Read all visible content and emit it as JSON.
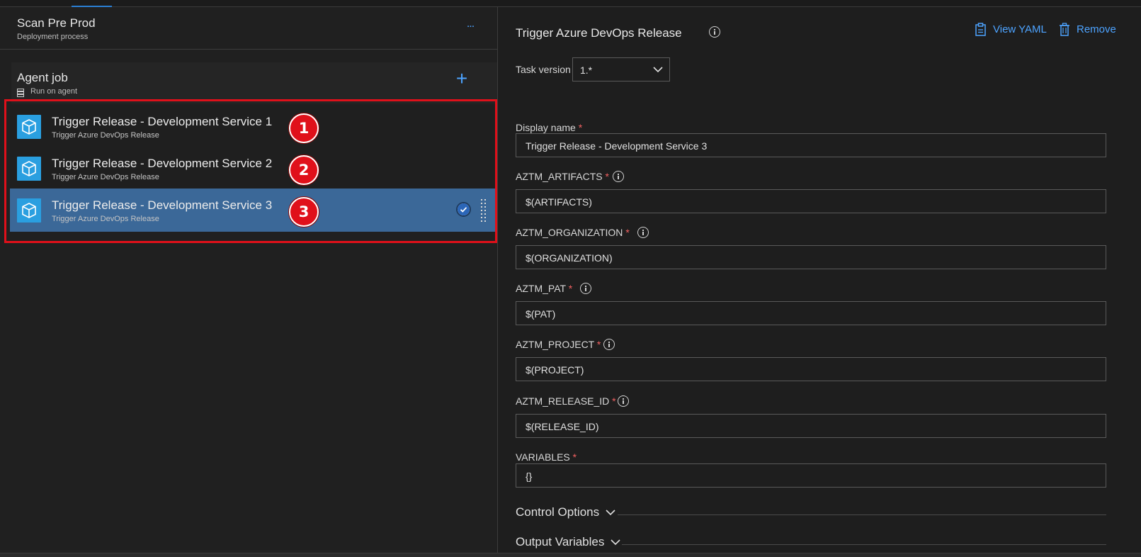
{
  "stage": {
    "title": "Scan Pre Prod",
    "subtitle": "Deployment process",
    "more_label": "..."
  },
  "agent_job": {
    "title": "Agent job",
    "subtitle": "Run on agent",
    "add_label": "+"
  },
  "tasks": [
    {
      "title": "Trigger Release - Development Service 1",
      "subtitle": "Trigger Azure DevOps Release",
      "badge": "1",
      "selected": false
    },
    {
      "title": "Trigger Release - Development Service 2",
      "subtitle": "Trigger Azure DevOps Release",
      "badge": "2",
      "selected": false
    },
    {
      "title": "Trigger Release - Development Service 3",
      "subtitle": "Trigger Azure DevOps Release",
      "badge": "3",
      "selected": true
    }
  ],
  "panel": {
    "title": "Trigger Azure DevOps Release",
    "view_yaml_label": "View YAML",
    "remove_label": "Remove",
    "task_version_label": "Task version",
    "task_version_value": "1.*",
    "required_mark": "*",
    "fields": [
      {
        "label": "Display name",
        "value": "Trigger Release - Development Service 3",
        "info": false
      },
      {
        "label": "AZTM_ARTIFACTS",
        "value": "$(ARTIFACTS)",
        "info": true
      },
      {
        "label": "AZTM_ORGANIZATION",
        "value": "$(ORGANIZATION)",
        "info": true
      },
      {
        "label": "AZTM_PAT",
        "value": "$(PAT)",
        "info": true
      },
      {
        "label": "AZTM_PROJECT",
        "value": "$(PROJECT)",
        "info": true
      },
      {
        "label": "AZTM_RELEASE_ID",
        "value": "$(RELEASE_ID)",
        "info": true
      },
      {
        "label": "VARIABLES",
        "value": "{}",
        "info": false
      }
    ],
    "sections": [
      {
        "label": "Control Options"
      },
      {
        "label": "Output Variables"
      }
    ]
  },
  "colors": {
    "accent": "#4da3ff",
    "selected_row": "#3b6898",
    "highlight_border": "#e0101a",
    "required": "#f06060",
    "task_icon": "#2a9fe0"
  }
}
